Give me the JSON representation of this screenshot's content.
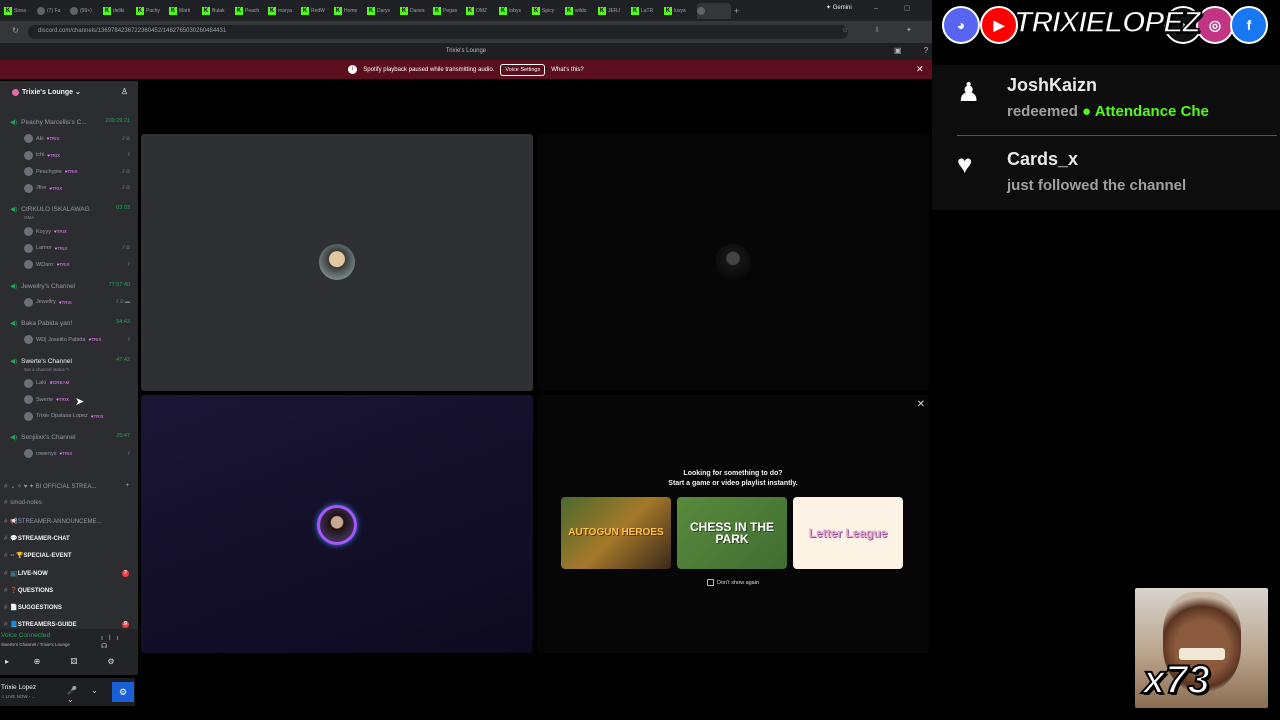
{
  "browser": {
    "tabs": [
      {
        "label": "Strea",
        "fav": "k"
      },
      {
        "label": "(7) Fa",
        "fav": "g"
      },
      {
        "label": "(99+)",
        "fav": "g"
      },
      {
        "label": "deliki",
        "fav": "k"
      },
      {
        "label": "Pachy",
        "fav": "k"
      },
      {
        "label": "Marti",
        "fav": "k"
      },
      {
        "label": "Bulak",
        "fav": "k"
      },
      {
        "label": "Peach",
        "fav": "k"
      },
      {
        "label": "marya",
        "fav": "k"
      },
      {
        "label": "RedW",
        "fav": "k"
      },
      {
        "label": "Home",
        "fav": "k"
      },
      {
        "label": "Darys",
        "fav": "k"
      },
      {
        "label": "Danes",
        "fav": "k"
      },
      {
        "label": "Pegas",
        "fav": "k"
      },
      {
        "label": "OMZ",
        "fav": "k"
      },
      {
        "label": "tobys",
        "fav": "k"
      },
      {
        "label": "Spicy",
        "fav": "k"
      },
      {
        "label": "wildo",
        "fav": "k"
      },
      {
        "label": "JERJ",
        "fav": "k"
      },
      {
        "label": "LaTR",
        "fav": "k"
      },
      {
        "label": "luvya",
        "fav": "k"
      }
    ],
    "active_tab": {
      "label": "",
      "fav": "g"
    },
    "new_tab": "+",
    "gemini": "✦ Gemini",
    "window_controls": "– ▢ ✕",
    "nav": "↻",
    "url": "discord.com/channels/1369784236722360452/1462765030260484431",
    "addr_icons": "☆ ⇩ ✦ ⋮"
  },
  "discord": {
    "title": "Trixie's Lounge",
    "top_icons": "▣ ?",
    "notice": {
      "text": "Spotify playback paused while transmitting audio.",
      "button": "Voice Settings",
      "link": "What's this?",
      "close": "✕"
    },
    "server_name": "Trixie's Lounge ⌄",
    "invite_icon": "♙",
    "channels": [
      {
        "name": "Peachy Marcellis's C...",
        "time": "200:29:21",
        "users": [
          {
            "name": "Aki",
            "badge": "♥TRIX",
            "icon": "⫽ ⊘"
          },
          {
            "name": "ichi",
            "badge": "♥TRIX",
            "icon": "⫽"
          },
          {
            "name": "Peachypie",
            "badge": "♥TRIX",
            "icon": "⫽ ⊘"
          },
          {
            "name": "Jfire",
            "badge": "♥TRIX",
            "icon": "⫽ ⊘"
          }
        ]
      },
      {
        "name": "CIRKULO ISKALAWAG",
        "time": "03 03",
        "status": "OMA",
        "users": [
          {
            "name": "Koyyy",
            "badge": "♥TRIX",
            "icon": ""
          },
          {
            "name": "Lamor",
            "badge": "♥TRIX",
            "icon": "⫽ ⊘"
          },
          {
            "name": "WDarrr",
            "badge": "♥TRIX",
            "icon": "⫽"
          }
        ]
      },
      {
        "name": "Jewellry's Channel",
        "time": "77:57:40",
        "users": [
          {
            "name": "Jewellry",
            "badge": "♥TRIX",
            "icon": "⫽ ⊘ ▬"
          }
        ]
      },
      {
        "name": "Baka Pabida yan!",
        "time": "54:43",
        "users": [
          {
            "name": "WD| Joselito Pabida",
            "badge": "♥TRIX",
            "icon": "⫽"
          }
        ]
      },
      {
        "name": "Swerte's Channel",
        "time": "47:42",
        "status": "Set a channel status ✎",
        "active": true,
        "users": [
          {
            "name": "Laki",
            "badge": "♛DREAM",
            "icon": ""
          },
          {
            "name": "Swerte",
            "badge": "♥TRIX",
            "icon": ""
          },
          {
            "name": "Trixie Opalasa Lopez",
            "badge": "♥TRIX",
            "icon": ""
          }
        ]
      },
      {
        "name": "Senjiiixx's Channel",
        "time": "25:47",
        "users": [
          {
            "name": "rowenys",
            "badge": "♥TRIX",
            "icon": "⫽"
          }
        ]
      }
    ],
    "text_channels": [
      {
        "name": "⌄ ✧ ♥ ✦ BI OFFICIAL STREA...",
        "plus": "+",
        "dim": true
      },
      {
        "name": "smod-notes",
        "dim": true
      },
      {
        "name": "📢STREAMER-ANNOUNCEME...",
        "dim": true
      },
      {
        "name": "💬STREAMER-CHAT"
      },
      {
        "name": "·· 🏆SPECIAL-EVENT"
      },
      {
        "name": "📺LIVE-NOW",
        "count": "7"
      },
      {
        "name": "❓QUESTIONS"
      },
      {
        "name": "📄SUGGESTIONS"
      },
      {
        "name": "📘STREAMERS-GUIDE",
        "count": "9"
      }
    ],
    "voice": {
      "status": "Voice Connected",
      "location": "Swerte's Channel / Trixie's Lounge",
      "tools": "ılı ☊",
      "buttons": [
        "▸",
        "⊕",
        "⚄",
        "⚙"
      ]
    },
    "user": {
      "name": "Trixie Lopez",
      "status": "♫ LIVE NOW - ...",
      "controls": "🎤 ⌄ 🎧 ⌄",
      "settings": "⚙"
    },
    "activity": {
      "close": "✕",
      "title_line1": "Looking for something to do?",
      "title_line2": "Start a game or video playlist instantly.",
      "games": [
        "AUTOGUN HEROES",
        "CHESS IN THE PARK",
        "Letter League"
      ],
      "dont_show": "Don't show again"
    }
  },
  "stream": {
    "social_icons": [
      "discord",
      "youtube",
      "tiktok",
      "instagram",
      "facebook"
    ],
    "social_glyphs": [
      "◕",
      "▶",
      "♪",
      "◎",
      "f"
    ],
    "brand": "TRIXIELOPEZ",
    "alerts": [
      {
        "icon": "♟",
        "user": "JoshKaizn",
        "action": "redeemed",
        "reward": "● Attendance Che"
      },
      {
        "icon": "♥",
        "user": "Cards_x",
        "action": "just followed the channel"
      }
    ],
    "multiplier": "x73"
  },
  "colors": {
    "discord_bg": "#2b2d31",
    "voice_green": "#23a55a",
    "notice_red": "#5b0e1e",
    "kick_green": "#53fc18"
  }
}
